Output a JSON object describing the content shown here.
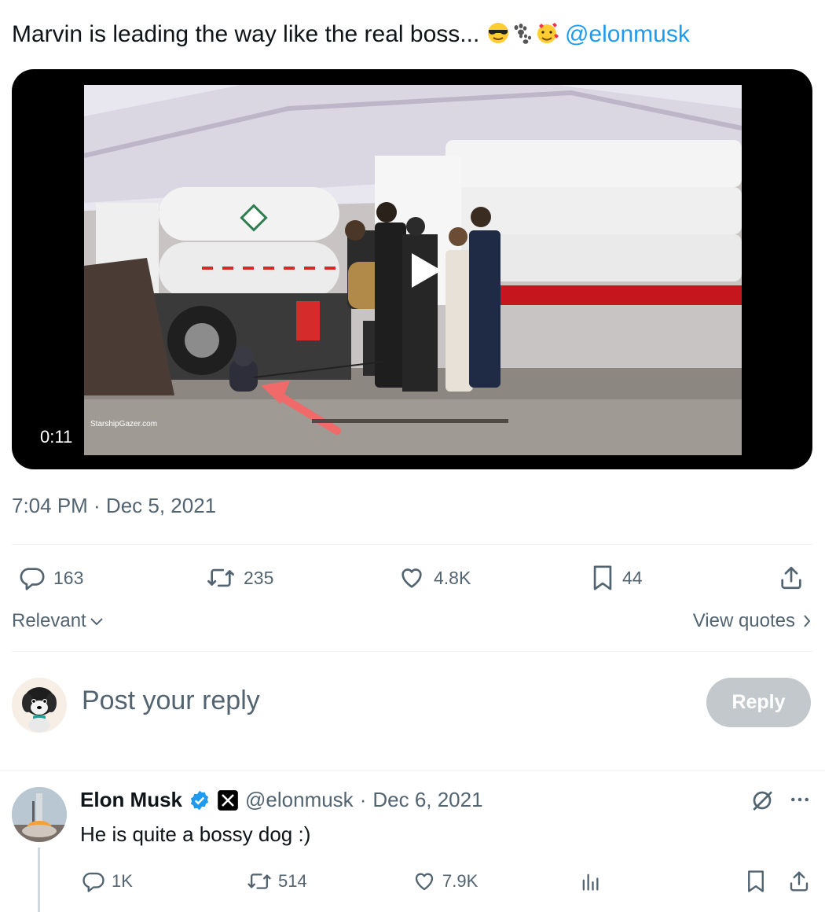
{
  "tweet": {
    "text": "Marvin is leading the way like the real boss... ",
    "mention": "@elonmusk",
    "video_duration": "0:11",
    "timestamp": "7:04 PM · Dec 5, 2021",
    "watermark": "StarshipGazer.com",
    "stats": {
      "replies": "163",
      "reposts": "235",
      "likes": "4.8K",
      "bookmarks": "44"
    },
    "emojis": [
      "sunglasses-face",
      "paw-prints",
      "smiling-face-with-hearts"
    ]
  },
  "sort": {
    "label": "Relevant"
  },
  "view_quotes": {
    "label": "View quotes"
  },
  "composer": {
    "placeholder": "Post your reply",
    "button_label": "Reply"
  },
  "reply": {
    "author_name": "Elon Musk",
    "handle": "@elonmusk",
    "date": "Dec 6, 2021",
    "text": "He is quite a bossy dog :)",
    "stats": {
      "replies": "1K",
      "reposts": "514",
      "likes": "7.9K"
    },
    "verified": true
  },
  "colors": {
    "accent": "#1d9bf0",
    "muted": "#536471",
    "reply_button": "#c2c8cc"
  }
}
